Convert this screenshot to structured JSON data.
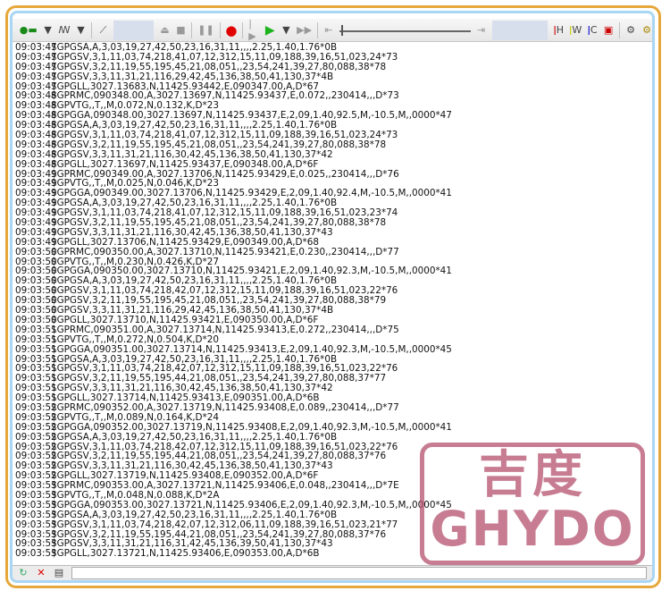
{
  "toolbar": {
    "icons": [
      "connect-icon",
      "dropdown-icon",
      "signal-icon",
      "dropdown-icon",
      "wand-icon",
      "eject-icon",
      "stop-icon",
      "pause-icon",
      "record-icon",
      "step-icon",
      "play-icon",
      "dropdown-icon",
      "fast-forward-icon",
      "skip-start-icon",
      "skip-end-icon",
      "thermometer-h-icon",
      "thermometer-w-icon",
      "thermometer-c-icon",
      "panel-icon",
      "gear-icon",
      "gear-warn-icon"
    ],
    "labels": {
      "h": "H",
      "w": "W",
      "c": "C"
    },
    "record_color": "#e00000",
    "play_color": "#1db31d"
  },
  "log": [
    {
      "t": "09:03:47",
      "m": "$GPGSA,A,3,03,19,27,42,50,23,16,31,11,,,,2.25,1.40,1.76*0B"
    },
    {
      "t": "09:03:47",
      "m": "$GPGSV,3,1,11,03,74,218,41,07,12,312,15,11,09,188,39,16,51,023,24*73"
    },
    {
      "t": "09:03:47",
      "m": "$GPGSV,3,2,11,19,55,195,45,21,08,051,,23,54,241,39,27,80,088,38*78"
    },
    {
      "t": "09:03:47",
      "m": "$GPGSV,3,3,11,31,21,116,29,42,45,136,38,50,41,130,37*4B"
    },
    {
      "t": "09:03:47",
      "m": "$GPGLL,3027.13683,N,11425.93442,E,090347.00,A,D*67"
    },
    {
      "t": "09:03:48",
      "m": "$GPRMC,090348.00,A,3027.13697,N,11425.93437,E,0.072,,230414,,,D*73"
    },
    {
      "t": "09:03:48",
      "m": "$GPVTG,,T,,M,0.072,N,0.132,K,D*23"
    },
    {
      "t": "09:03:48",
      "m": "$GPGGA,090348.00,3027.13697,N,11425.93437,E,2,09,1.40,92.5,M,-10.5,M,,0000*47"
    },
    {
      "t": "09:03:48",
      "m": "$GPGSA,A,3,03,19,27,42,50,23,16,31,11,,,,2.25,1.40,1.76*0B"
    },
    {
      "t": "09:03:48",
      "m": "$GPGSV,3,1,11,03,74,218,41,07,12,312,15,11,09,188,39,16,51,023,24*73"
    },
    {
      "t": "09:03:48",
      "m": "$GPGSV,3,2,11,19,55,195,45,21,08,051,,23,54,241,39,27,80,088,38*78"
    },
    {
      "t": "09:03:48",
      "m": "$GPGSV,3,3,11,31,21,116,30,42,45,136,38,50,41,130,37*42"
    },
    {
      "t": "09:03:48",
      "m": "$GPGLL,3027.13697,N,11425.93437,E,090348.00,A,D*6F"
    },
    {
      "t": "09:03:49",
      "m": "$GPRMC,090349.00,A,3027.13706,N,11425.93429,E,0.025,,230414,,,D*76"
    },
    {
      "t": "09:03:49",
      "m": "$GPVTG,,T,,M,0.025,N,0.046,K,D*23"
    },
    {
      "t": "09:03:49",
      "m": "$GPGGA,090349.00,3027.13706,N,11425.93429,E,2,09,1.40,92.4,M,-10.5,M,,0000*41"
    },
    {
      "t": "09:03:49",
      "m": "$GPGSA,A,3,03,19,27,42,50,23,16,31,11,,,,2.25,1.40,1.76*0B"
    },
    {
      "t": "09:03:49",
      "m": "$GPGSV,3,1,11,03,74,218,41,07,12,312,15,11,09,188,39,16,51,023,23*74"
    },
    {
      "t": "09:03:49",
      "m": "$GPGSV,3,2,11,19,55,195,45,21,08,051,,23,54,241,39,27,80,088,38*78"
    },
    {
      "t": "09:03:49",
      "m": "$GPGSV,3,3,11,31,21,116,30,42,45,136,38,50,41,130,37*43"
    },
    {
      "t": "09:03:49",
      "m": "$GPGLL,3027.13706,N,11425.93429,E,090349.00,A,D*68"
    },
    {
      "t": "09:03:50",
      "m": "$GPRMC,090350.00,A,3027.13710,N,11425.93421,E,0.230,,230414,,,D*77"
    },
    {
      "t": "09:03:50",
      "m": "$GPVTG,,T,,M,0.230,N,0.426,K,D*27"
    },
    {
      "t": "09:03:50",
      "m": "$GPGGA,090350.00,3027.13710,N,11425.93421,E,2,09,1.40,92.3,M,-10.5,M,,0000*41"
    },
    {
      "t": "09:03:50",
      "m": "$GPGSA,A,3,03,19,27,42,50,23,16,31,11,,,,2.25,1.40,1.76*0B"
    },
    {
      "t": "09:03:50",
      "m": "$GPGSV,3,1,11,03,74,218,42,07,12,312,15,11,09,188,39,16,51,023,22*76"
    },
    {
      "t": "09:03:50",
      "m": "$GPGSV,3,2,11,19,55,195,45,21,08,051,,23,54,241,39,27,80,088,38*79"
    },
    {
      "t": "09:03:50",
      "m": "$GPGSV,3,3,11,31,21,116,29,42,45,136,38,50,41,130,37*4B"
    },
    {
      "t": "09:03:50",
      "m": "$GPGLL,3027.13710,N,11425.93421,E,090350.00,A,D*6F"
    },
    {
      "t": "09:03:51",
      "m": "$GPRMC,090351.00,A,3027.13714,N,11425.93413,E,0.272,,230414,,,D*75"
    },
    {
      "t": "09:03:51",
      "m": "$GPVTG,,T,,M,0.272,N,0.504,K,D*20"
    },
    {
      "t": "09:03:51",
      "m": "$GPGGA,090351.00,3027.13714,N,11425.93413,E,2,09,1.40,92.3,M,-10.5,M,,0000*45"
    },
    {
      "t": "09:03:51",
      "m": "$GPGSA,A,3,03,19,27,42,50,23,16,31,11,,,,2.25,1.40,1.76*0B"
    },
    {
      "t": "09:03:51",
      "m": "$GPGSV,3,1,11,03,74,218,42,07,12,312,15,11,09,188,39,16,51,023,22*76"
    },
    {
      "t": "09:03:51",
      "m": "$GPGSV,3,2,11,19,55,195,44,21,08,051,,23,54,241,39,27,80,088,37*77"
    },
    {
      "t": "09:03:51",
      "m": "$GPGSV,3,3,11,31,21,116,30,42,45,136,38,50,41,130,37*42"
    },
    {
      "t": "09:03:51",
      "m": "$GPGLL,3027.13714,N,11425.93413,E,090351.00,A,D*6B"
    },
    {
      "t": "09:03:52",
      "m": "$GPRMC,090352.00,A,3027.13719,N,11425.93408,E,0.089,,230414,,,D*77"
    },
    {
      "t": "09:03:52",
      "m": "$GPVTG,,T,,M,0.089,N,0.164,K,D*24"
    },
    {
      "t": "09:03:52",
      "m": "$GPGGA,090352.00,3027.13719,N,11425.93408,E,2,09,1.40,92.3,M,-10.5,M,,0000*41"
    },
    {
      "t": "09:03:52",
      "m": "$GPGSA,A,3,03,19,27,42,50,23,16,31,11,,,,2.25,1.40,1.76*0B"
    },
    {
      "t": "09:03:52",
      "m": "$GPGSV,3,1,11,03,74,218,42,07,12,312,15,11,09,188,39,16,51,023,22*76"
    },
    {
      "t": "09:03:52",
      "m": "$GPGSV,3,2,11,19,55,195,44,21,08,051,,23,54,241,39,27,80,088,37*76"
    },
    {
      "t": "09:03:52",
      "m": "$GPGSV,3,3,11,31,21,116,30,42,45,136,38,50,41,130,37*43"
    },
    {
      "t": "09:03:52",
      "m": "$GPGLL,3027.13719,N,11425.93408,E,090352.00,A,D*6F"
    },
    {
      "t": "09:03:53",
      "m": "$GPRMC,090353.00,A,3027.13721,N,11425.93406,E,0.048,,230414,,,D*7E"
    },
    {
      "t": "09:03:53",
      "m": "$GPVTG,,T,,M,0.048,N,0.088,K,D*2A"
    },
    {
      "t": "09:03:53",
      "m": "$GPGGA,090353.00,3027.13721,N,11425.93406,E,2,09,1.40,92.3,M,-10.5,M,,0000*45"
    },
    {
      "t": "09:03:53",
      "m": "$GPGSA,A,3,03,19,27,42,50,23,16,31,11,,,,2.25,1.40,1.76*0B"
    },
    {
      "t": "09:03:53",
      "m": "$GPGSV,3,1,11,03,74,218,42,07,12,312,06,11,09,188,39,16,51,023,21*77"
    },
    {
      "t": "09:03:53",
      "m": "$GPGSV,3,2,11,19,55,195,44,21,08,051,,23,54,241,39,27,80,088,37*76"
    },
    {
      "t": "09:03:53",
      "m": "$GPGSV,3,3,11,31,21,116,31,42,45,136,39,50,41,130,37*43"
    },
    {
      "t": "09:03:53",
      "m": "$GPGLL,3027.13721,N,11425.93406,E,090353.00,A,D*6B"
    }
  ],
  "watermark": {
    "cn": "吉度",
    "en": "GHYDO",
    "color": "#b4506e"
  },
  "frame_colors": {
    "outer": "#e6a83c",
    "inner": "#a9d6f2"
  }
}
